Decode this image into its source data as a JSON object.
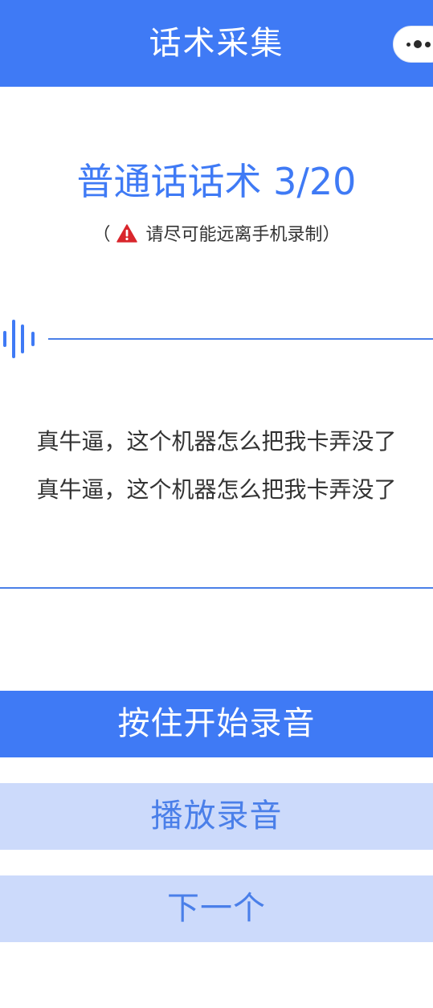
{
  "nav": {
    "title": "话术采集",
    "more_icon": "more-dots-icon"
  },
  "colors": {
    "primary": "#3f7af5",
    "primary_light": "#ccdafb",
    "warning": "#d9262c"
  },
  "header": {
    "title": "普通话话术 3/20",
    "hint_open": "（",
    "hint_text": "请尽可能远离手机录制）",
    "warning_icon": "warning-triangle-icon"
  },
  "recorder": {
    "wave_icon": "sound-wave-icon"
  },
  "script": {
    "lines": [
      "真牛逼，这个机器怎么把我卡弄没了",
      "真牛逼，这个机器怎么把我卡弄没了"
    ]
  },
  "buttons": {
    "record": "按住开始录音",
    "play": "播放录音",
    "next": "下一个"
  }
}
